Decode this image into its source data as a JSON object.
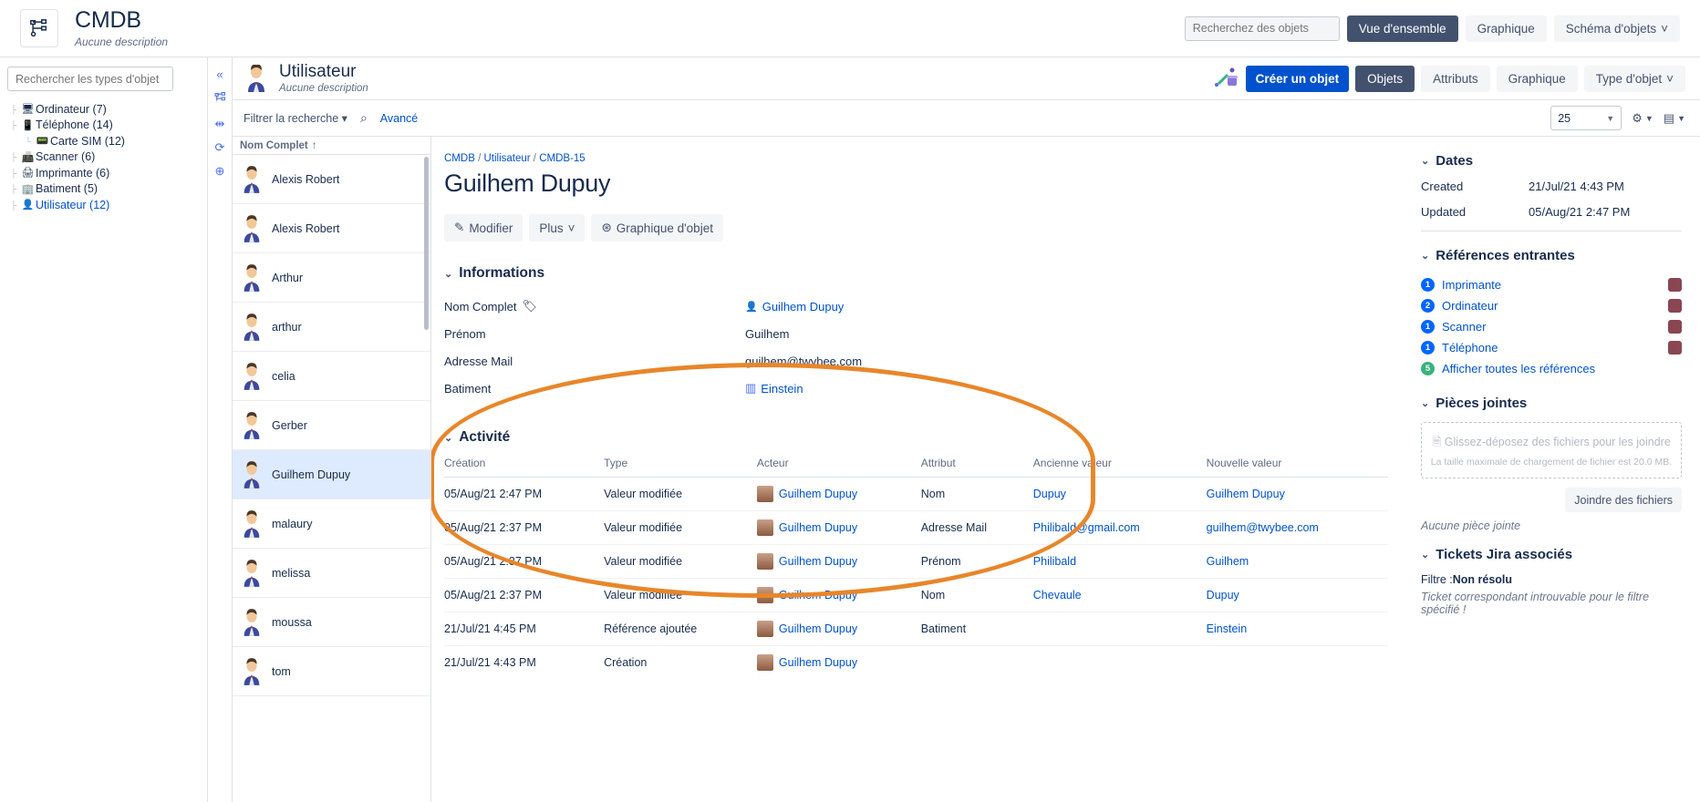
{
  "topbar": {
    "logo_icon": "sitemap-icon",
    "title": "CMDB",
    "subtitle": "Aucune description",
    "search_placeholder": "Recherchez des objets",
    "search_value": "",
    "nav": [
      {
        "label": "Vue d'ensemble",
        "active": true
      },
      {
        "label": "Graphique",
        "active": false
      },
      {
        "label": "Schéma d'objets",
        "active": false,
        "caret": "˅"
      }
    ]
  },
  "typetree": {
    "search_placeholder": "Rechercher les types d'objet",
    "search_value": "",
    "items": [
      {
        "icon": "🖥",
        "label": "Ordinateur (7)",
        "level": 1,
        "selected": false
      },
      {
        "icon": "📱",
        "label": "Téléphone (14)",
        "level": 1,
        "selected": false
      },
      {
        "icon": "📟",
        "label": "Carte SIM (12)",
        "level": 2,
        "selected": false
      },
      {
        "icon": "📠",
        "label": "Scanner (6)",
        "level": 1,
        "selected": false
      },
      {
        "icon": "🖨",
        "label": "Imprimante (6)",
        "level": 1,
        "selected": false
      },
      {
        "icon": "🏢",
        "label": "Batiment (5)",
        "level": 1,
        "selected": false
      },
      {
        "icon": "👤",
        "label": "Utilisateur (12)",
        "level": 1,
        "selected": true
      }
    ]
  },
  "rail": {
    "icons": [
      "collapse-left-icon",
      "sitemap-icon",
      "collapse-arrows-icon",
      "refresh-icon",
      "add-circle-icon"
    ]
  },
  "objpanel": {
    "avatar": "user-avatar",
    "title": "Utilisateur",
    "subtitle": "Aucune description",
    "lightning_icon": "automation-icon",
    "create_label": "Créer un objet",
    "tabs": [
      {
        "label": "Objets",
        "active": true
      },
      {
        "label": "Attributs",
        "active": false
      },
      {
        "label": "Graphique",
        "active": false
      },
      {
        "label": "Type d'objet",
        "active": false,
        "caret": "˅"
      }
    ],
    "filter_label": "Filtrer la recherche",
    "search_icon": "search-icon",
    "advanced_label": "Avancé",
    "page_size": "25",
    "gear_icon": "gear-icon",
    "columns_icon": "columns-layout-icon"
  },
  "objlist": {
    "header": "Nom Complet",
    "sort_arrow": "↑",
    "items": [
      {
        "name": "Alexis Robert",
        "active": false
      },
      {
        "name": "Alexis Robert",
        "active": false
      },
      {
        "name": "Arthur",
        "active": false
      },
      {
        "name": "arthur",
        "active": false
      },
      {
        "name": "celia",
        "active": false
      },
      {
        "name": "Gerber",
        "active": false
      },
      {
        "name": "Guilhem Dupuy",
        "active": true
      },
      {
        "name": "malaury",
        "active": false
      },
      {
        "name": "melissa",
        "active": false
      },
      {
        "name": "moussa",
        "active": false
      },
      {
        "name": "tom",
        "active": false
      }
    ]
  },
  "detail": {
    "breadcrumb": {
      "root": "CMDB",
      "type": "Utilisateur",
      "key": "CMDB-15"
    },
    "title": "Guilhem Dupuy",
    "buttons": [
      {
        "label": "Modifier",
        "icon": "pencil-icon"
      },
      {
        "label": "Plus",
        "caret": "˅"
      },
      {
        "label": "Graphique d'objet",
        "icon": "object-graph-icon"
      }
    ],
    "informations": {
      "heading": "Informations",
      "rows": [
        {
          "label": "Nom Complet",
          "tag_icon": "tag-icon",
          "value": "Guilhem Dupuy",
          "link": true,
          "icon": "user-icon"
        },
        {
          "label": "Prénom",
          "value": "Guilhem",
          "link": false
        },
        {
          "label": "Adresse Mail",
          "value": "guilhem@twybee.com",
          "link": false
        },
        {
          "label": "Batiment",
          "value": "Einstein",
          "link": true,
          "icon": "building-icon"
        }
      ]
    },
    "activity": {
      "heading": "Activité",
      "columns": [
        "Création",
        "Type",
        "Acteur",
        "Attribut",
        "Ancienne valeur",
        "Nouvelle valeur"
      ],
      "rows": [
        {
          "creation": "05/Aug/21 2:47 PM",
          "type": "Valeur modifiée",
          "acteur": "Guilhem Dupuy",
          "attribut": "Nom",
          "ancienne": "Dupuy",
          "nouvelle": "Guilhem Dupuy"
        },
        {
          "creation": "05/Aug/21 2:37 PM",
          "type": "Valeur modifiée",
          "acteur": "Guilhem Dupuy",
          "attribut": "Adresse Mail",
          "ancienne": "Philibald@gmail.com",
          "nouvelle": "guilhem@twybee.com"
        },
        {
          "creation": "05/Aug/21 2:37 PM",
          "type": "Valeur modifiée",
          "acteur": "Guilhem Dupuy",
          "attribut": "Prénom",
          "ancienne": "Philibald",
          "nouvelle": "Guilhem"
        },
        {
          "creation": "05/Aug/21 2:37 PM",
          "type": "Valeur modifiée",
          "acteur": "Guilhem Dupuy",
          "attribut": "Nom",
          "ancienne": "Chevaule",
          "nouvelle": "Dupuy"
        },
        {
          "creation": "21/Jul/21 4:45 PM",
          "type": "Référence ajoutée",
          "acteur": "Guilhem Dupuy",
          "attribut": "Batiment",
          "ancienne": "",
          "nouvelle": "Einstein"
        },
        {
          "creation": "21/Jul/21 4:43 PM",
          "type": "Création",
          "acteur": "Guilhem Dupuy",
          "attribut": "",
          "ancienne": "",
          "nouvelle": ""
        }
      ]
    }
  },
  "side": {
    "dates": {
      "heading": "Dates",
      "created_label": "Created",
      "created_value": "21/Jul/21 4:43 PM",
      "updated_label": "Updated",
      "updated_value": "05/Aug/21 2:47 PM"
    },
    "references": {
      "heading": "Références entrantes",
      "items": [
        {
          "count": "1",
          "label": "Imprimante",
          "swatch": "#8a4652",
          "green": false
        },
        {
          "count": "2",
          "label": "Ordinateur",
          "swatch": "#8a4652",
          "green": false
        },
        {
          "count": "1",
          "label": "Scanner",
          "swatch": "#8a4652",
          "green": false
        },
        {
          "count": "1",
          "label": "Téléphone",
          "swatch": "#8a4652",
          "green": false
        }
      ],
      "show_all": {
        "count": "5",
        "label": "Afficher toutes les références",
        "green": true
      }
    },
    "attachments": {
      "heading": "Pièces jointes",
      "dropzone_icon": "attachment-icon",
      "dropzone_main": "Glissez-déposez des fichiers pour les joindre",
      "dropzone_sub": "La taille maximale de chargement de fichier est 20.0 MB.",
      "button": "Joindre des fichiers",
      "empty": "Aucune pièce jointe"
    },
    "jira": {
      "heading": "Tickets Jira associés",
      "filter_label": "Filtre :",
      "filter_value": "Non résolu",
      "empty": "Ticket correspondant introuvable pour le filtre spécifié !"
    }
  },
  "colors": {
    "accent_blue": "#0052cc",
    "dark_nav": "#42526e",
    "highlight_orange": "#e8862a",
    "badge_blue": "#0065ff",
    "badge_green": "#36b37e"
  }
}
